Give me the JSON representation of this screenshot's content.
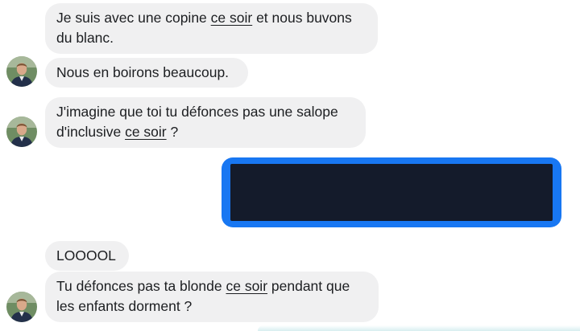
{
  "conversation": {
    "messages": [
      {
        "sender": "incoming",
        "lines": [
          [
            "Je suis avec une copine ",
            "ce soir",
            " et nous buvons"
          ],
          [
            "du blanc."
          ]
        ]
      },
      {
        "sender": "incoming",
        "lines": [
          [
            "Nous en boirons beaucoup."
          ]
        ]
      },
      {
        "sender": "incoming",
        "lines": [
          [
            "J'imagine que toi tu défonces pas une salope"
          ],
          [
            "d'inclusive ",
            "ce soir",
            " ?"
          ]
        ]
      },
      {
        "sender": "outgoing",
        "redacted": true
      },
      {
        "sender": "incoming",
        "lines": [
          [
            "LOOOOL"
          ]
        ]
      },
      {
        "sender": "incoming",
        "lines": [
          [
            "Tu défonces pas ta blonde ",
            "ce soir",
            " pendant que"
          ],
          [
            "les enfants dorment ?"
          ]
        ]
      }
    ]
  },
  "colors": {
    "incoming_bubble": "#f0f0f1",
    "outgoing_bubble": "#1877f2",
    "redaction_block": "#141b2b",
    "text": "#1c1e21"
  },
  "icons": {
    "avatar": "contact-avatar"
  }
}
